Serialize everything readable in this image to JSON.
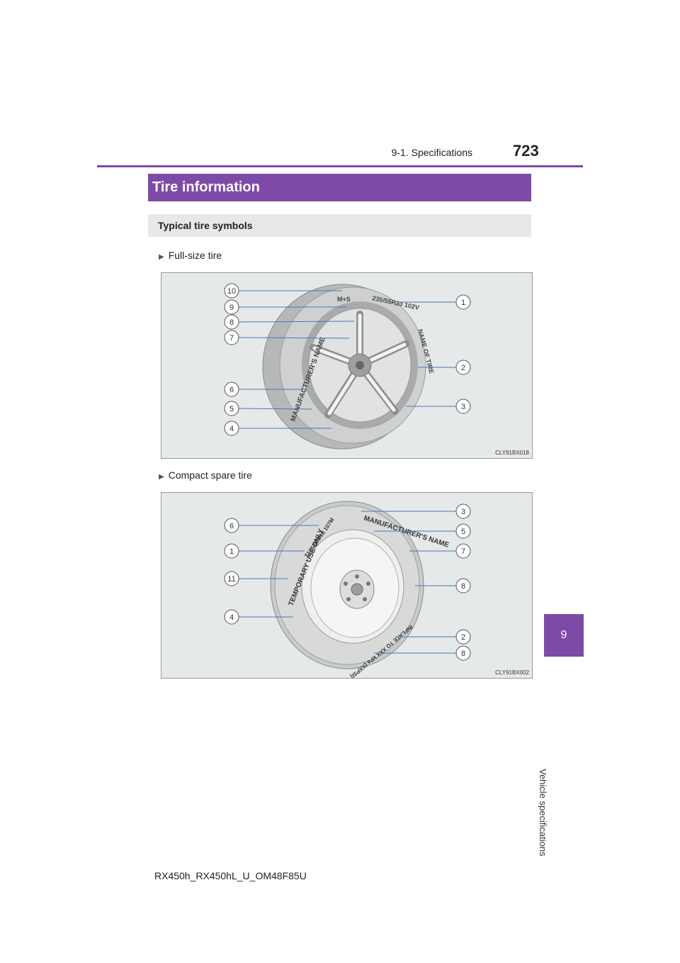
{
  "header": {
    "section": "9-1. Specifications",
    "page_number": "723"
  },
  "side_tab": {
    "number": "9",
    "text": "Vehicle specifications"
  },
  "title": "Tire information",
  "subtitle": "Typical tire symbols",
  "figures": [
    {
      "caption": "Full-size tire",
      "code": "CLY91BX018",
      "callouts_left": [
        "10",
        "9",
        "8",
        "7",
        "6",
        "5",
        "4"
      ],
      "callouts_right": [
        "1",
        "2",
        "3"
      ],
      "tire_text": {
        "ms": "M+S",
        "size": "235/55R20 102V",
        "mfr": "MANUFACTURER'S NAME",
        "name": "NAME OF TIRE"
      }
    },
    {
      "caption": "Compact spare tire",
      "code": "CLY91BX002",
      "callouts_left": [
        "6",
        "1",
        "11",
        "4"
      ],
      "callouts_right": [
        "3",
        "5",
        "7",
        "8",
        "2",
        "8"
      ],
      "tire_text": {
        "temp": "TEMPORARY USE ONLY",
        "size": "T165/90D18 107M",
        "mfr": "MANUFACTURER'S NAME",
        "inflate": "INFLATE TO XXX kPa (XXPSI)"
      }
    }
  ],
  "footer": "RX450h_RX450hL_U_OM48F85U",
  "colors": {
    "accent": "#7e4aa8",
    "callout_line": "#4a78b0"
  }
}
